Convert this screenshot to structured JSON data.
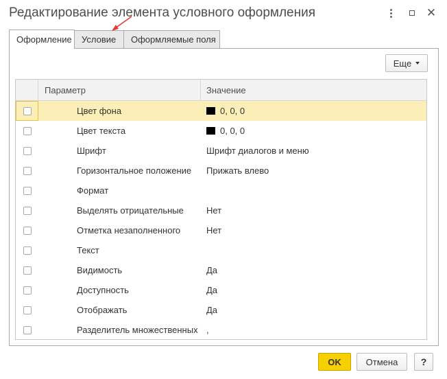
{
  "window": {
    "title": "Редактирование элемента условного оформления"
  },
  "tabs": [
    {
      "label": "Оформление",
      "active": true
    },
    {
      "label": "Условие",
      "active": false
    },
    {
      "label": "Оформляемые поля",
      "active": false
    }
  ],
  "toolbar": {
    "more_label": "Еще"
  },
  "table": {
    "columns": [
      "Параметр",
      "Значение"
    ],
    "rows": [
      {
        "param": "Цвет фона",
        "value": "0, 0, 0",
        "swatch": "#000000",
        "checked": false,
        "selected": true
      },
      {
        "param": "Цвет текста",
        "value": "0, 0, 0",
        "swatch": "#000000",
        "checked": false
      },
      {
        "param": "Шрифт",
        "value": "Шрифт диалогов и меню",
        "checked": false
      },
      {
        "param": "Горизонтальное положение",
        "value": "Прижать влево",
        "checked": false
      },
      {
        "param": "Формат",
        "value": "",
        "checked": false
      },
      {
        "param": "Выделять отрицательные",
        "value": "Нет",
        "checked": false
      },
      {
        "param": "Отметка незаполненного",
        "value": "Нет",
        "checked": false
      },
      {
        "param": "Текст",
        "value": "",
        "checked": false
      },
      {
        "param": "Видимость",
        "value": "Да",
        "checked": false
      },
      {
        "param": "Доступность",
        "value": "Да",
        "checked": false
      },
      {
        "param": "Отображать",
        "value": "Да",
        "checked": false
      },
      {
        "param": "Разделитель множественных ...",
        "value": ",",
        "checked": false
      }
    ]
  },
  "footer": {
    "ok_label": "OK",
    "cancel_label": "Отмена",
    "help_label": "?"
  },
  "colors": {
    "selected_row": "#fbeeb6",
    "ok_button": "#f6d000",
    "annotation_arrow": "#e53935"
  }
}
